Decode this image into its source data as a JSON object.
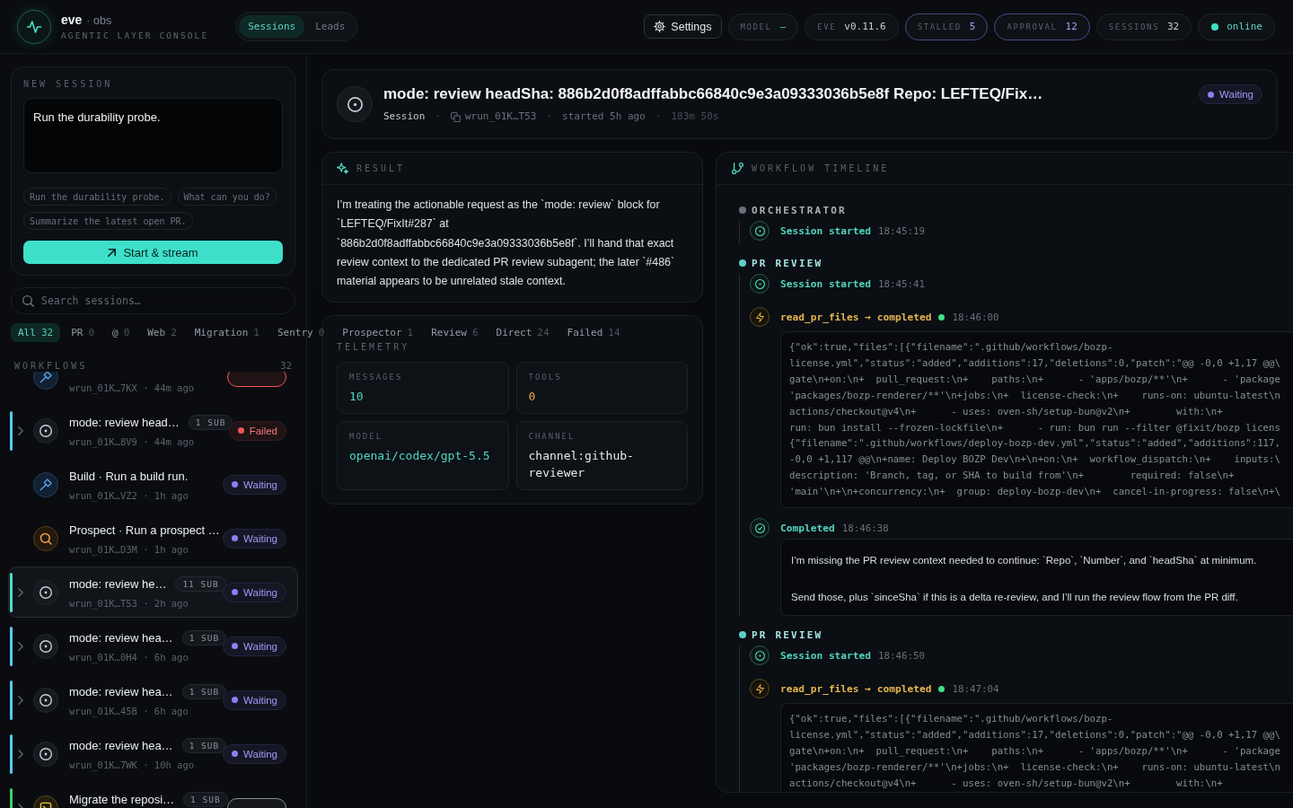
{
  "header": {
    "brand": "eve",
    "brand_suffix": "· obs",
    "tagline": "AGENTIC LAYER CONSOLE",
    "nav_tabs": [
      {
        "label": "Sessions",
        "selected": true
      },
      {
        "label": "Leads",
        "selected": false
      }
    ],
    "settings": "Settings",
    "stats": [
      {
        "label": "MODEL",
        "value": "–",
        "kind": "accent"
      },
      {
        "label": "EVE",
        "value": "v0.11.6",
        "kind": "plain"
      },
      {
        "label": "STALLED",
        "value": "5",
        "kind": "alert"
      },
      {
        "label": "APPROVAL",
        "value": "12",
        "kind": "alert"
      },
      {
        "label": "SESSIONS",
        "value": "32",
        "kind": "plain"
      }
    ],
    "connection": {
      "label": "online",
      "online": true
    }
  },
  "new_session": {
    "title": "NEW SESSION",
    "prompt": "Run the durability probe.",
    "suggestions": [
      "Run the durability probe.",
      "What can you do?",
      "Summarize the latest open PR."
    ],
    "start_button": "Start & stream"
  },
  "search": {
    "placeholder": "Search sessions…"
  },
  "filters": [
    {
      "label": "All",
      "count": "32",
      "selected": true
    },
    {
      "label": "PR",
      "count": "0",
      "selected": false
    },
    {
      "label": "@",
      "count": "0",
      "selected": false
    },
    {
      "label": "Web",
      "count": "2",
      "selected": false
    },
    {
      "label": "Migration",
      "count": "1",
      "selected": false
    },
    {
      "label": "Sentry",
      "count": "0",
      "selected": false
    },
    {
      "label": "Prospector",
      "count": "1",
      "selected": false
    },
    {
      "label": "Review",
      "count": "6",
      "selected": false
    },
    {
      "label": "Direct",
      "count": "24",
      "selected": false
    },
    {
      "label": "Failed",
      "count": "14",
      "selected": false
    }
  ],
  "workflows": {
    "title": "WORKFLOWS",
    "count": "32",
    "rows": [
      {
        "kind": "build",
        "meta": "wrun_01K…7KX · 44m ago",
        "status": {
          "color": "#f05555"
        },
        "expandable": false,
        "selected": false
      },
      {
        "kind": "review",
        "title": "mode: review head…",
        "subs": "1 SUB",
        "meta": "wrun_01K…8V9 · 44m ago",
        "status": {
          "label": "Failed",
          "color": "#f05555"
        },
        "expandable": true,
        "color": "#5cc6f2",
        "selected": false
      },
      {
        "kind": "build",
        "title": "Build · Run a build run.",
        "meta": "wrun_01K…VZ2 · 1h ago",
        "status": {
          "label": "Waiting",
          "color": "#8d7ef5"
        },
        "expandable": false,
        "selected": false
      },
      {
        "kind": "prospect",
        "title": "Prospect · Run a prospect …",
        "meta": "wrun_01K…D3M · 1h ago",
        "status": {
          "label": "Waiting",
          "color": "#8d7ef5"
        },
        "expandable": false,
        "selected": false
      },
      {
        "kind": "review",
        "title": "mode: review he…",
        "subs": "11 SUB",
        "meta": "wrun_01K…T53 · 2h ago",
        "status": {
          "label": "Waiting",
          "color": "#8d7ef5"
        },
        "expandable": true,
        "color": "#4fdccb",
        "selected": true
      },
      {
        "kind": "review",
        "title": "mode: review hea…",
        "subs": "1 SUB",
        "meta": "wrun_01K…0H4 · 6h ago",
        "status": {
          "label": "Waiting",
          "color": "#8d7ef5"
        },
        "expandable": true,
        "color": "#5cc6f2",
        "selected": false
      },
      {
        "kind": "review",
        "title": "mode: review hea…",
        "subs": "1 SUB",
        "meta": "wrun_01K…45B · 6h ago",
        "status": {
          "label": "Waiting",
          "color": "#8d7ef5"
        },
        "expandable": true,
        "color": "#5cc6f2",
        "selected": false
      },
      {
        "kind": "review",
        "title": "mode: review hea…",
        "subs": "1 SUB",
        "meta": "wrun_01K…7WK · 10h ago",
        "status": {
          "label": "Waiting",
          "color": "#8d7ef5"
        },
        "expandable": true,
        "color": "#5cc6f2",
        "selected": false
      },
      {
        "kind": "migrate",
        "title": "Migrate the reposi…",
        "subs": "1 SUB",
        "status": {
          "color": "#8a8f96"
        },
        "expandable": true,
        "color": "#3fd06a",
        "selected": false
      }
    ]
  },
  "session": {
    "title": "mode: review headSha: 886b2d0f8adffabbc66840c9e3a09333036b5e8f Repo: LEFTEQ/Fix…",
    "separator": "·",
    "meta": [
      {
        "text": "Session",
        "kind": "type"
      },
      {
        "text": "wrun_01K…T53",
        "kind": "id"
      },
      {
        "text": "started 5h ago",
        "kind": "plain"
      },
      {
        "text": "183m 50s",
        "kind": "dim"
      }
    ],
    "status": {
      "label": "Waiting",
      "color": "#8d7ef5"
    }
  },
  "result": {
    "title": "RESULT",
    "text": "I’m treating the actionable request as the `mode: review` block for `LEFTEQ/FixIt#287` at `886b2d0f8adffabbc66840c9e3a09333036b5e8f`. I’ll hand that exact review context to the dedicated PR review subagent; the later `#486` material appears to be unrelated stale context."
  },
  "telemetry": {
    "title": "TELEMETRY",
    "tiles": [
      {
        "label": "MESSAGES",
        "value": "10",
        "kind": "accent"
      },
      {
        "label": "TOOLS",
        "value": "0",
        "kind": "warning"
      },
      {
        "label": "MODEL",
        "value": "openai/codex/gpt-5.5",
        "kind": "accent"
      },
      {
        "label": "CHANNEL",
        "value": "channel:github-reviewer",
        "kind": "plain"
      }
    ]
  },
  "timeline": {
    "title": "WORKFLOW TIMELINE",
    "groups": [
      {
        "label": "ORCHESTRATOR",
        "color": "#6b7079",
        "events": [
          {
            "kind": "session",
            "label": "Session started",
            "time": "18:45:19"
          }
        ]
      },
      {
        "label": "PR REVIEW",
        "color": "#5fcfcc",
        "events": [
          {
            "kind": "session",
            "label": "Session started",
            "time": "18:45:41"
          },
          {
            "kind": "tool",
            "label": "read_pr_files → completed",
            "ok": true,
            "time": "18:46:00",
            "output": [
              "{\"ok\":true,\"files\":[{\"filename\":\".github/workflows/bozp-",
              "license.yml\",\"status\":\"added\",\"additions\":17,\"deletions\":0,\"patch\":\"@@ -0,0 +1,17 @@\\",
              "gate\\n+on:\\n+  pull_request:\\n+    paths:\\n+      - 'apps/bozp/**'\\n+      - 'package",
              "'packages/bozp-renderer/**'\\n+jobs:\\n+  license-check:\\n+    runs-on: ubuntu-latest\\n",
              "actions/checkout@v4\\n+      - uses: oven-sh/setup-bun@v2\\n+        with:\\n+",
              "run: bun install --frozen-lockfile\\n+      - run: bun run --filter @fixit/bozp licens",
              "{\"filename\":\".github/workflows/deploy-bozp-dev.yml\",\"status\":\"added\",\"additions\":117,",
              "-0,0 +1,117 @@\\n+name: Deploy BOZP Dev\\n+\\n+on:\\n+  workflow_dispatch:\\n+    inputs:\\",
              "description: 'Branch, tag, or SHA to build from'\\n+        required: false\\n+",
              "'main'\\n+\\n+concurrency:\\n+  group: deploy-bozp-dev\\n+  cancel-in-progress: false\\n+\\"
            ]
          },
          {
            "kind": "completed",
            "label": "Completed",
            "time": "18:46:38",
            "message": [
              "I’m missing the PR review context needed to continue: `Repo`, `Number`, and `headSha` at minimum.",
              "Send those, plus `sinceSha` if this is a delta re-review, and I’ll run the review flow from the PR diff."
            ]
          }
        ]
      },
      {
        "label": "PR REVIEW",
        "color": "#5fcfcc",
        "events": [
          {
            "kind": "session",
            "label": "Session started",
            "time": "18:46:50"
          },
          {
            "kind": "tool",
            "label": "read_pr_files → completed",
            "ok": true,
            "time": "18:47:04",
            "output": [
              "{\"ok\":true,\"files\":[{\"filename\":\".github/workflows/bozp-",
              "license.yml\",\"status\":\"added\",\"additions\":17,\"deletions\":0,\"patch\":\"@@ -0,0 +1,17 @@\\",
              "gate\\n+on:\\n+  pull_request:\\n+    paths:\\n+      - 'apps/bozp/**'\\n+      - 'package",
              "'packages/bozp-renderer/**'\\n+jobs:\\n+  license-check:\\n+    runs-on: ubuntu-latest\\n",
              "actions/checkout@v4\\n+      - uses: oven-sh/setup-bun@v2\\n+        with:\\n+"
            ]
          }
        ]
      }
    ]
  }
}
